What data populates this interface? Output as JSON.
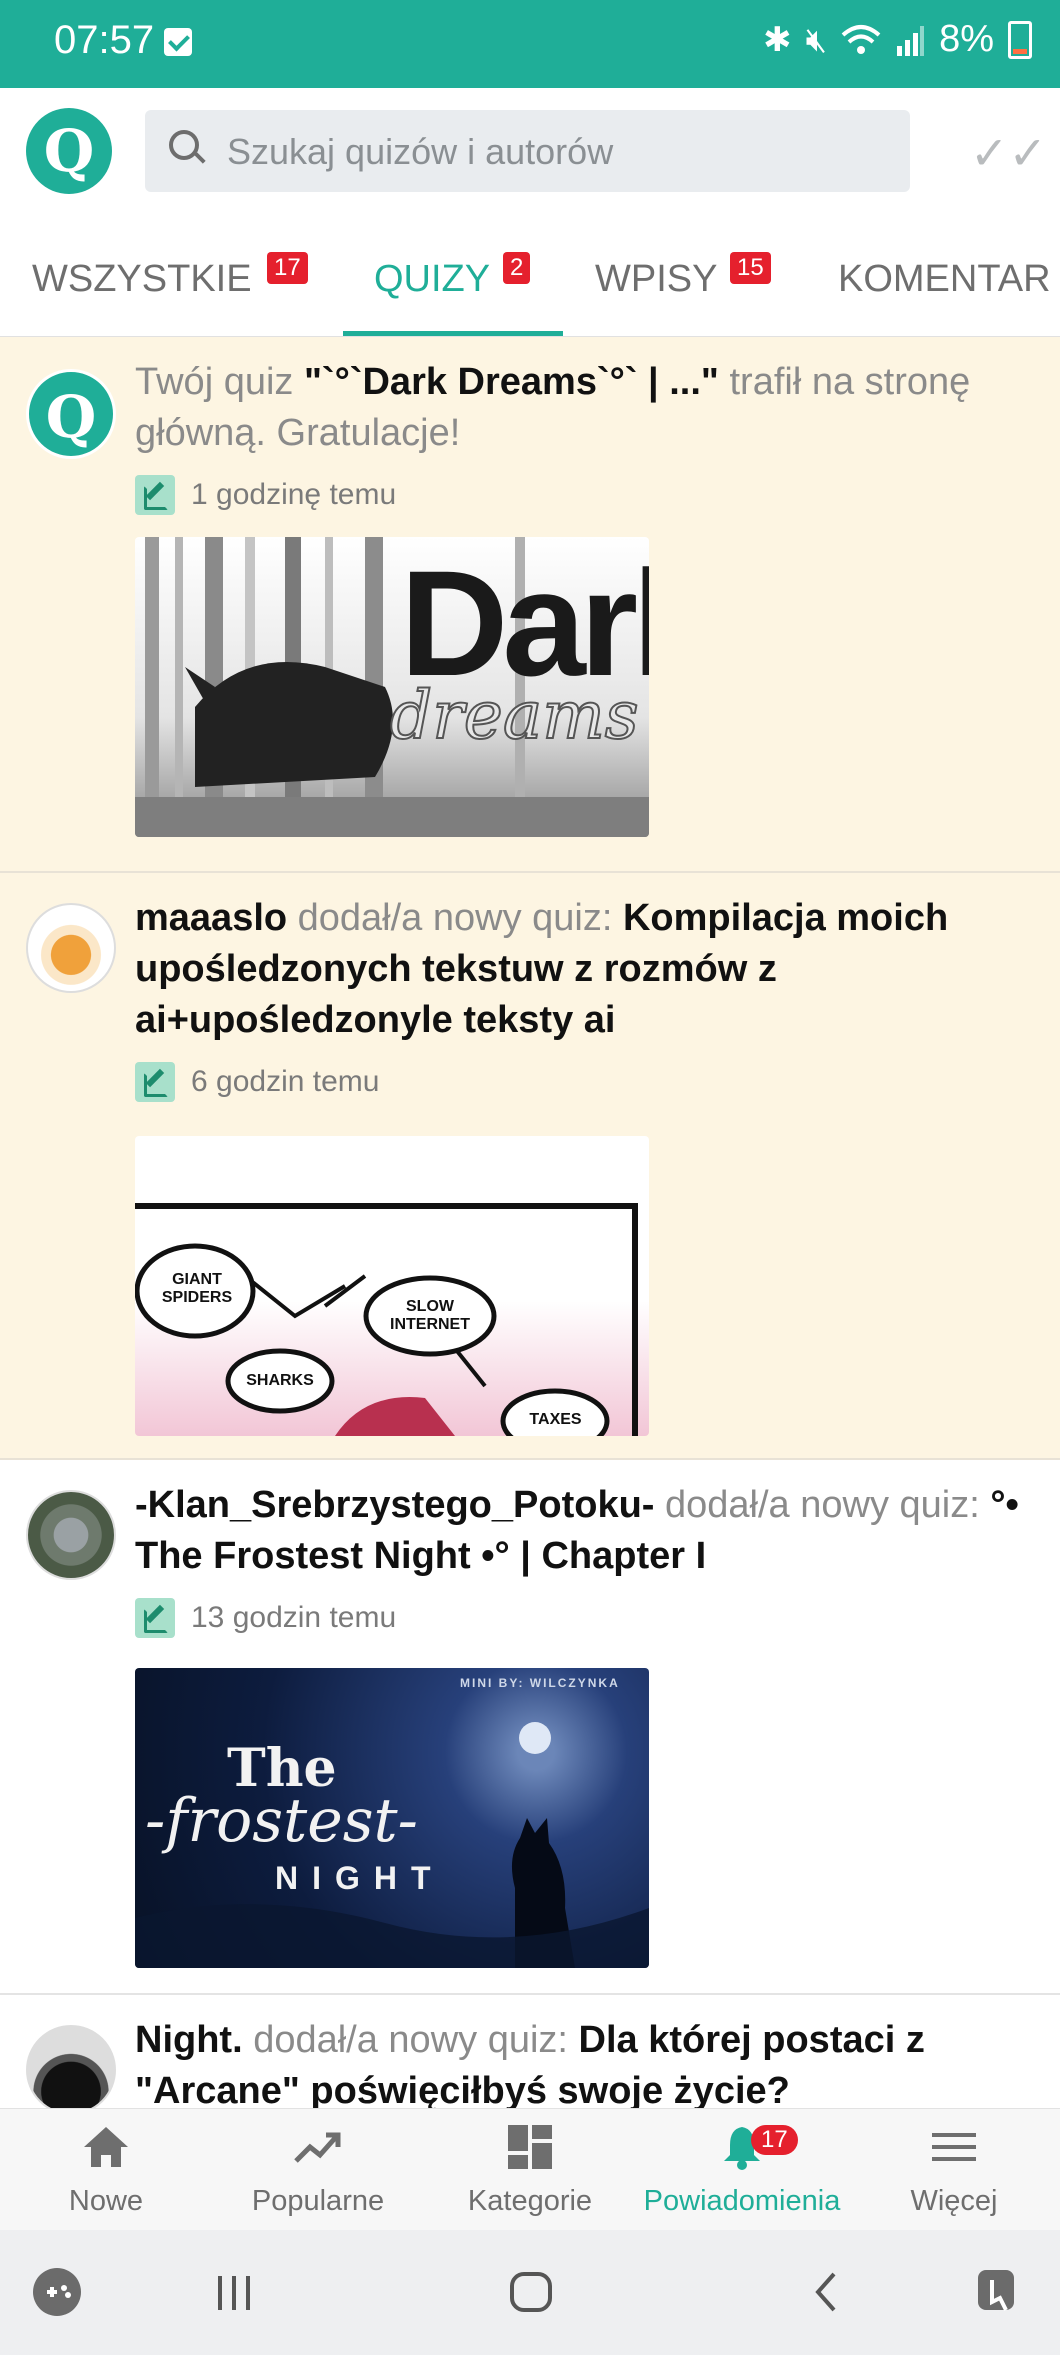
{
  "status_bar": {
    "time": "07:57",
    "battery": "8%"
  },
  "search": {
    "placeholder": "Szukaj quizów i autorów"
  },
  "tabs": [
    {
      "label": "WSZYSTKIE",
      "badge": "17"
    },
    {
      "label": "QUIZY",
      "badge": "2"
    },
    {
      "label": "WPISY",
      "badge": "15"
    },
    {
      "label": "KOMENTAR"
    }
  ],
  "notifications": [
    {
      "prefix": "Twój quiz ",
      "title": "\"`°`Dark Dreams`°` | ...\"",
      "suffix": " trafił na stronę główną. Gratulacje!",
      "time": "1 godzinę temu",
      "thumb": {
        "big": "Dark",
        "script": "dreams"
      }
    },
    {
      "author": "maaaslo",
      "action": " dodał/a nowy quiz: ",
      "title": "Kompilacja moich upośledzonych tekstuw z rozmów z ai+upośledzonyle teksty ai",
      "time": "6 godzin temu",
      "thumb": {
        "bubble1": "GIANT SPIDERS",
        "bubble2": "SLOW INTERNET",
        "bubble3": "SHARKS",
        "bubble4": "TAXES"
      }
    },
    {
      "author": "-Klan_Srebrzystego_Potoku-",
      "action": " dodał/a nowy quiz: ",
      "title": "°• The Frostest Night •° | Chapter I",
      "time": "13 godzin temu",
      "thumb": {
        "credit": "MINI BY: WILCZYNKA",
        "the": "The",
        "frostest": "-frostest-",
        "night": "NIGHT"
      }
    },
    {
      "author": "Night.",
      "action": " dodał/a nowy quiz: ",
      "title": "Dla której postaci z \"Arcane\" poświęciłbyś swoje życie?"
    }
  ],
  "bottom_nav": [
    {
      "label": "Nowe",
      "icon": "home-icon"
    },
    {
      "label": "Popularne",
      "icon": "trending-icon"
    },
    {
      "label": "Kategorie",
      "icon": "dashboard-icon"
    },
    {
      "label": "Powiadomienia",
      "icon": "bell-icon",
      "badge": "17"
    },
    {
      "label": "Więcej",
      "icon": "menu-icon"
    }
  ],
  "colors": {
    "accent": "#1fae98",
    "unread_bg": "#fdf5e2",
    "badge": "#e5202d"
  }
}
